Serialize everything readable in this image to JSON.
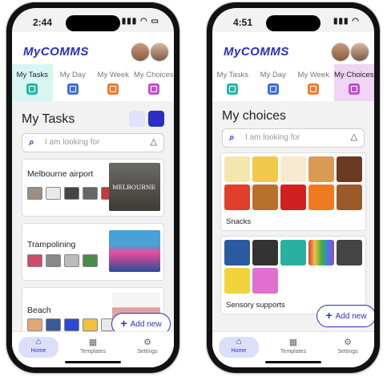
{
  "colors": {
    "brand": "#2a2fc4",
    "tasks": "#26b8a6",
    "day": "#3d6fd6",
    "week": "#f07a2a",
    "choices": "#c24fd1"
  },
  "tabs": [
    {
      "label": "My Tasks",
      "icon": "tasks-icon"
    },
    {
      "label": "My Day",
      "icon": "day-calendar-icon"
    },
    {
      "label": "My Week",
      "icon": "week-calendar-icon"
    },
    {
      "label": "My Choices",
      "icon": "choices-icon"
    }
  ],
  "nav": {
    "home": "Home",
    "templates": "Templates",
    "settings": "Settings"
  },
  "add_new": "Add new",
  "logo": "MyCOMMS",
  "left": {
    "time": "2:44",
    "page_title": "My Tasks",
    "search_placeholder": "I am looking for",
    "tasks": [
      {
        "title": "Melbourne airport",
        "photo_label": "MELBOURNE"
      },
      {
        "title": "Trampolining"
      },
      {
        "title": "Beach"
      }
    ]
  },
  "right": {
    "time": "4:51",
    "page_title": "My choices",
    "search_placeholder": "I am looking for",
    "groups": [
      {
        "title": "Snacks"
      },
      {
        "title": "Sensory supports"
      }
    ]
  }
}
